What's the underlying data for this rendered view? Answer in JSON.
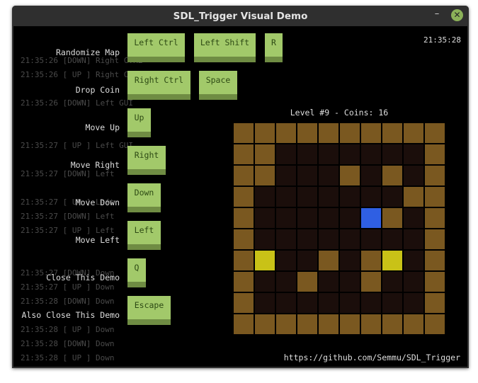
{
  "window": {
    "title": "SDL_Trigger Visual Demo",
    "minimize_glyph": "–",
    "close_glyph": "✕"
  },
  "clock": "21:35:28",
  "log": [
    "21:35:26 [DOWN] Right CTRL",
    "21:35:26 [ UP ] Right CTRL",
    "21:35:26 [DOWN] Left GUI",
    "21:35:27 [ UP ] Left GUI",
    "21:35:27 [DOWN] Left",
    "21:35:27 [ UP ] Left",
    "21:35:27 [DOWN] Left",
    "21:35:27 [ UP ] Left",
    "21:35:27 [DOWN] Down",
    "21:35:27 [ UP ] Down",
    "21:35:28 [DOWN] Down",
    "21:35:28 [ UP ] Down",
    "21:35:28 [DOWN] Down",
    "21:35:28 [ UP ] Down"
  ],
  "actions": [
    {
      "label": "Randomize Map",
      "keys": [
        "Left Ctrl",
        "Left Shift",
        "R"
      ]
    },
    {
      "label": "Drop Coin",
      "keys": [
        "Right Ctrl",
        "Space"
      ]
    },
    {
      "label": "Move Up",
      "keys": [
        "Up"
      ]
    },
    {
      "label": "Move Right",
      "keys": [
        "Right"
      ]
    },
    {
      "label": "Move Down",
      "keys": [
        "Down"
      ]
    },
    {
      "label": "Move Left",
      "keys": [
        "Left"
      ]
    },
    {
      "label": "Close This Demo",
      "keys": [
        "Q"
      ]
    },
    {
      "label": "Also Close This Demo",
      "keys": [
        "Escape"
      ]
    }
  ],
  "game": {
    "level_info": "Level #9 - Coins: 16",
    "legend": {
      "#": "wall",
      ".": "floor",
      "c": "coin",
      "P": "player"
    },
    "map": [
      "##########",
      "##.......#",
      "##...#.#.#",
      "#.......##",
      "#.....P#.#",
      "#........#",
      "#c..#.#c.#",
      "#..#..#..#",
      "#........#",
      "##########"
    ]
  },
  "footer": {
    "repo_link": "https://github.com/Semmu/SDL_Trigger"
  },
  "colors": {
    "wall": "#7a5820",
    "floor": "#1b0e0b",
    "coin": "#c9c217",
    "player": "#2f5fe3",
    "key_face": "#a2c96a",
    "key_shadow": "#6f8c43",
    "accent_close": "#8bb158"
  }
}
